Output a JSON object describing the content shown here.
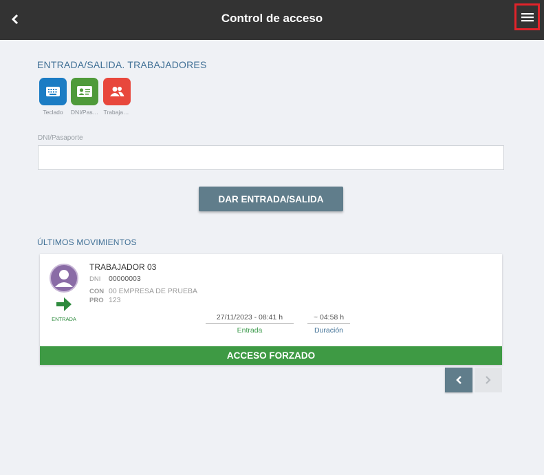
{
  "header": {
    "title": "Control de acceso",
    "back_icon": "chevron-left-icon",
    "menu_icon": "hamburger-menu-icon",
    "menu_highlight_color": "#e2232a"
  },
  "entry_section": {
    "title": "ENTRADA/SALIDA. TRABAJADORES",
    "modes": [
      {
        "label": "Teclado",
        "icon": "keyboard-icon",
        "color": "#1b7cc4"
      },
      {
        "label": "DNI/Pas…",
        "icon": "id-card-icon",
        "color": "#4f9a3a"
      },
      {
        "label": "Trabaja…",
        "icon": "users-icon",
        "color": "#e8473c"
      }
    ],
    "field_label": "DNI/Pasaporte",
    "field_value": "",
    "submit_label": "DAR ENTRADA/SALIDA"
  },
  "movements": {
    "title": "ÚLTIMOS MOVIMIENTOS",
    "items": [
      {
        "name": "TRABAJADOR 03",
        "dni_key": "DNI",
        "dni": "00000003",
        "con_key": "CON",
        "con": "00 EMPRESA DE PRUEBA",
        "pro_key": "PRO",
        "pro": "123",
        "direction_label": "ENTRADA",
        "entry_time": "27/11/2023 - 08:41 h",
        "entry_caption": "Entrada",
        "duration": "~ 04:58 h",
        "duration_caption": "Duración",
        "status": "ACCESO FORZADO",
        "status_color": "#3e9a44"
      }
    ]
  },
  "pager": {
    "prev_icon": "chevron-left-icon",
    "next_icon": "chevron-right-icon",
    "next_enabled": false
  }
}
